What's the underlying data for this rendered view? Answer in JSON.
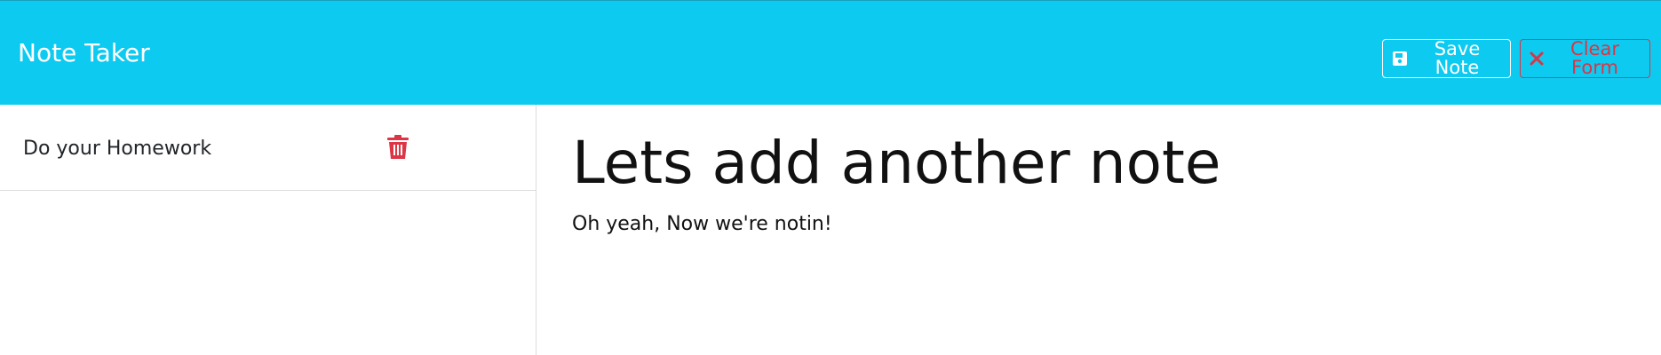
{
  "app": {
    "brand": "Note Taker"
  },
  "toolbar": {
    "save_label": "Save Note",
    "save_icon": "floppy-disk-icon",
    "clear_label": "Clear Form",
    "clear_icon": "x-icon"
  },
  "notes": [
    {
      "title": "Do your Homework",
      "delete_icon": "trash-icon"
    }
  ],
  "editor": {
    "title": "Lets add another note",
    "text": "Oh yeah, Now we're notin!"
  },
  "colors": {
    "navbar": "#0dcaf0",
    "danger": "#dc3545",
    "white": "#ffffff"
  }
}
